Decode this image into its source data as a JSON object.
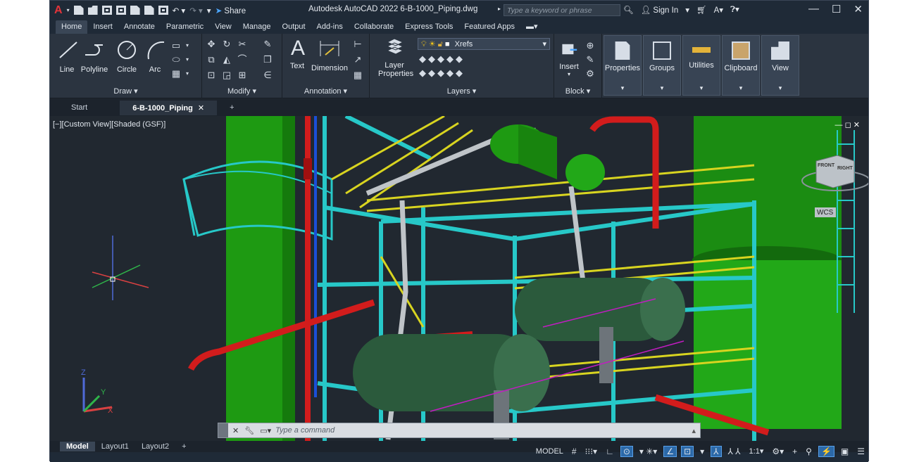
{
  "app": {
    "title": "Autodesk AutoCAD 2022   6-B-1000_Piping.dwg",
    "share": "Share",
    "search_placeholder": "Type a keyword or phrase",
    "sign_in": "Sign In"
  },
  "ribbon_tabs": [
    "Home",
    "Insert",
    "Annotate",
    "Parametric",
    "View",
    "Manage",
    "Output",
    "Add-ins",
    "Collaborate",
    "Express Tools",
    "Featured Apps"
  ],
  "draw": {
    "title": "Draw ▾",
    "line": "Line",
    "polyline": "Polyline",
    "circle": "Circle",
    "arc": "Arc"
  },
  "modify": {
    "title": "Modify ▾"
  },
  "annotation": {
    "title": "Annotation ▾",
    "text": "Text",
    "dimension": "Dimension"
  },
  "layers": {
    "title": "Layers ▾",
    "layer_properties_1": "Layer",
    "layer_properties_2": "Properties",
    "current_layer": "Xrefs"
  },
  "block": {
    "title": "Block ▾",
    "insert": "Insert"
  },
  "panels": {
    "properties": "Properties",
    "groups": "Groups",
    "utilities": "Utilities",
    "clipboard": "Clipboard",
    "view": "View"
  },
  "doc_tabs": {
    "start": "Start",
    "active": "6-B-1000_Piping"
  },
  "viewport": {
    "label": "[−][Custom View][Shaded (GSF)]",
    "ucs": "WCS",
    "cube_front": "FRONT",
    "cube_right": "RIGHT"
  },
  "command": {
    "placeholder": "Type  a  command"
  },
  "layout_tabs": [
    "Model",
    "Layout1",
    "Layout2"
  ],
  "status": {
    "model": "MODEL",
    "scale": "1:1"
  },
  "colors": {
    "accent": "#2c69a8",
    "structure": "#27c8c8",
    "railing": "#d8d420",
    "vessel": "#1e9a12",
    "pipe": "#d21c1c"
  }
}
